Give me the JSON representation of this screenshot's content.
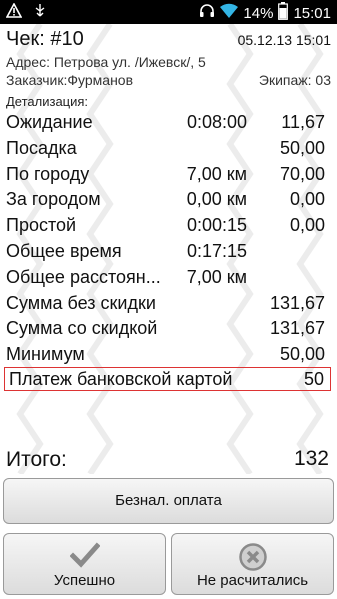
{
  "status_bar": {
    "battery": "14%",
    "time": "15:01"
  },
  "receipt": {
    "title": "Чек: #10",
    "date": "05.12.13 15:01",
    "address": "Адрес: Петрова ул. /Ижевск/, 5",
    "customer": "Заказчик:Фурманов",
    "crew": "Экипаж: 03",
    "detail_label": "Детализация:"
  },
  "rows": [
    {
      "label": "Ожидание",
      "mid": "0:08:00",
      "value": "11,67"
    },
    {
      "label": "Посадка",
      "mid": "",
      "value": "50,00"
    },
    {
      "label": "По городу",
      "mid": "7,00 км",
      "value": "70,00"
    },
    {
      "label": "За городом",
      "mid": "0,00 км",
      "value": "0,00"
    },
    {
      "label": "Простой",
      "mid": "0:00:15",
      "value": "0,00"
    },
    {
      "label": "Общее время",
      "mid": "0:17:15",
      "value": ""
    },
    {
      "label": "Общее расстоян...",
      "mid": "7,00 км",
      "value": ""
    },
    {
      "label": "Сумма без скидки",
      "mid": "",
      "value": "131,67"
    },
    {
      "label": "Сумма со скидкой",
      "mid": "",
      "value": "131,67"
    },
    {
      "label": "Минимум",
      "mid": "",
      "value": "50,00"
    }
  ],
  "card_payment": {
    "label": "Платеж банковской картой",
    "value": "50"
  },
  "total": {
    "label": "Итого:",
    "value": "132"
  },
  "buttons": {
    "beznal": "Безнал. оплата",
    "success": "Успешно",
    "not_paid": "Не расчитались"
  },
  "icons": {
    "success": "checkmark-icon",
    "not_paid": "cancel-circle-icon"
  },
  "colors": {
    "highlight_border": "#dd3333",
    "status_bar": "#000000",
    "icon_wifi": "#33b5e5"
  }
}
